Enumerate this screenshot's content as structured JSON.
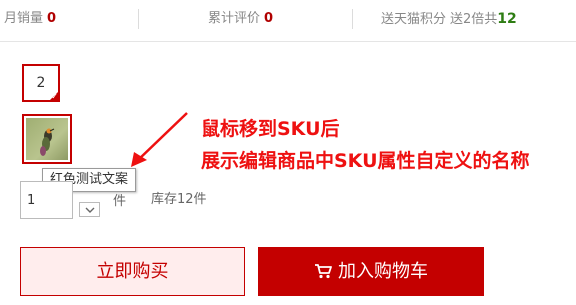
{
  "stats": {
    "monthly_sales_label": "月销量",
    "monthly_sales_value": "0",
    "reviews_label": "累计评价",
    "reviews_value": "0",
    "points_label": "送天猫积分",
    "points_doubled_label": "送2倍共",
    "points_value": "12"
  },
  "sku": {
    "text_option": "2",
    "image_option_alt": "红色测试文案",
    "tooltip": "红色测试文案"
  },
  "quantity": {
    "value": "1",
    "unit": "件",
    "stock_label": "库存12件"
  },
  "annotation": {
    "line1": "鼠标移到SKU后",
    "line2": "展示编辑商品中SKU属性自定义的名称"
  },
  "buttons": {
    "buy_now": "立即购买",
    "add_to_cart": "加入购物车"
  },
  "colors": {
    "brand_red": "#c40000",
    "annotation_red": "#ee1111",
    "points_green": "#2e7d13"
  },
  "icons": {
    "selected_corner": "checkmark-corner-icon",
    "quantity_down": "chevron-down-icon",
    "cart": "shopping-cart-icon"
  }
}
